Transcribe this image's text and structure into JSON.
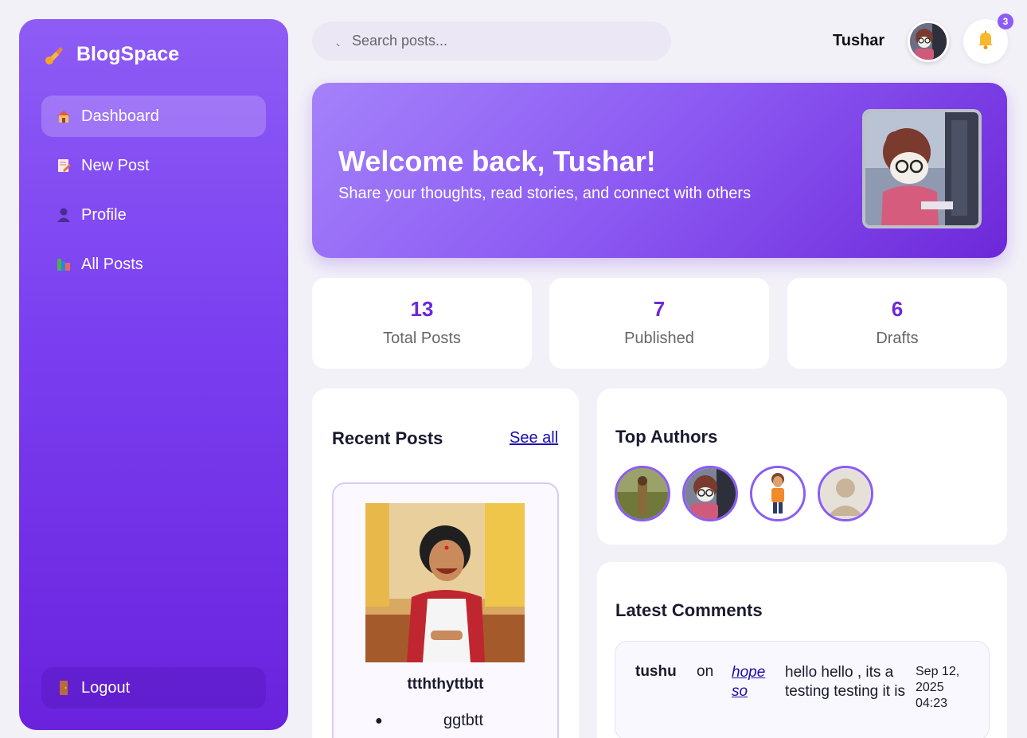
{
  "sidebar": {
    "brand": "BlogSpace",
    "nav": [
      {
        "label": "Dashboard",
        "icon": "house-icon",
        "active": true
      },
      {
        "label": "New Post",
        "icon": "memo-icon",
        "active": false
      },
      {
        "label": "Profile",
        "icon": "user-silhouette-icon",
        "active": false
      },
      {
        "label": "All Posts",
        "icon": "books-icon",
        "active": false
      }
    ],
    "logout": "Logout"
  },
  "header": {
    "search_placeholder": "Search posts...",
    "username": "Tushar",
    "notification_count": "3"
  },
  "hero": {
    "title": "Welcome back, Tushar!",
    "subtitle": "Share your thoughts, read stories, and connect with others"
  },
  "stats": [
    {
      "value": "13",
      "label": "Total Posts"
    },
    {
      "value": "7",
      "label": "Published"
    },
    {
      "value": "6",
      "label": "Drafts"
    }
  ],
  "recent_posts": {
    "title": "Recent Posts",
    "see_all": "See all",
    "items": [
      {
        "title": "ttththyttbtt",
        "excerpt": "ggtbtt"
      }
    ]
  },
  "top_authors": {
    "title": "Top Authors",
    "count": 4
  },
  "latest_comments": {
    "title": "Latest Comments",
    "items": [
      {
        "author": "tushu",
        "on": "on",
        "post": "hope so",
        "text": "hello hello , its a testing testing it is",
        "date": "Sep 12, 2025 04:23"
      }
    ]
  },
  "colors": {
    "accent": "#8b5cf6",
    "accent_dark": "#6d28d9",
    "background": "#f3f1f8",
    "link": "#1a0dab"
  }
}
